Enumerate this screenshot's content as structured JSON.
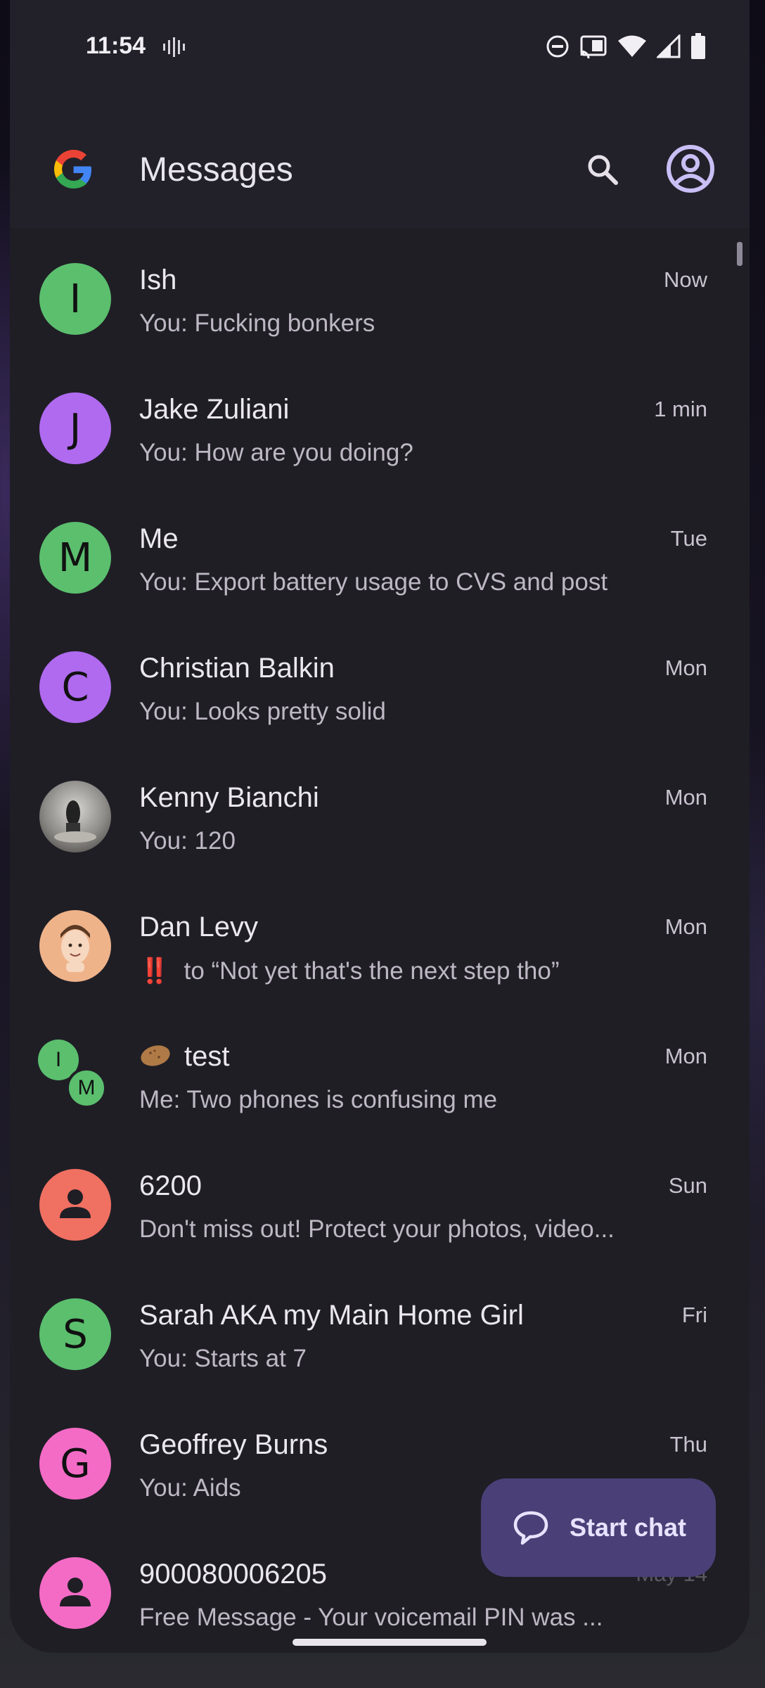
{
  "status_bar": {
    "time": "11:54",
    "icons": [
      "vibrate-icon",
      "do-not-disturb-icon",
      "cast-icon",
      "wifi-icon",
      "cell-signal-icon",
      "battery-icon"
    ]
  },
  "app_bar": {
    "title": "Messages",
    "logo": "google-g-logo",
    "search_icon": "search-icon",
    "account_icon": "account-circle-icon"
  },
  "conversations": [
    {
      "name": "Ish",
      "snippet": "You: Fucking bonkers",
      "time": "Now",
      "avatar_letter": "I",
      "avatar_color": "#5bbf6e"
    },
    {
      "name": "Jake Zuliani",
      "snippet": "You: How are you doing?",
      "time": "1 min",
      "avatar_letter": "J",
      "avatar_color": "#b06af0"
    },
    {
      "name": "Me",
      "snippet": "You: Export battery usage to CVS and post",
      "time": "Tue",
      "avatar_letter": "M",
      "avatar_color": "#5bbf6e"
    },
    {
      "name": "Christian Balkin",
      "snippet": "You: Looks pretty solid",
      "time": "Mon",
      "avatar_letter": "C",
      "avatar_color": "#b06af0"
    },
    {
      "name": "Kenny Bianchi",
      "snippet": "You: 120",
      "time": "Mon",
      "avatar_type": "photo"
    },
    {
      "name": "Dan Levy",
      "snippet": "to “Not yet that's the next step tho”",
      "snippet_prefix": "‼️",
      "time": "Mon",
      "avatar_type": "memoji"
    },
    {
      "name": "test",
      "name_emoji": "potato",
      "snippet": "Me: Two phones is confusing me",
      "time": "Mon",
      "avatar_type": "group",
      "group_letters": [
        "I",
        "M"
      ],
      "avatar_color": "#5bbf6e"
    },
    {
      "name": "6200",
      "snippet": "Don't miss out! Protect your photos, video...",
      "time": "Sun",
      "avatar_type": "person",
      "avatar_color": "#f07062"
    },
    {
      "name": "Sarah AKA my Main Home Girl",
      "snippet": "You: Starts at 7",
      "time": "Fri",
      "avatar_letter": "S",
      "avatar_color": "#5bbf6e"
    },
    {
      "name": "Geoffrey Burns",
      "snippet": "You: Aids",
      "time": "Thu",
      "avatar_letter": "G",
      "avatar_color": "#f46bc6"
    },
    {
      "name": "900080006205",
      "snippet": "Free Message - Your voicemail PIN was ...",
      "time": "May 14",
      "avatar_type": "person",
      "avatar_color": "#f46bc6"
    }
  ],
  "fab": {
    "label": "Start chat",
    "icon": "chat-bubble-icon"
  }
}
